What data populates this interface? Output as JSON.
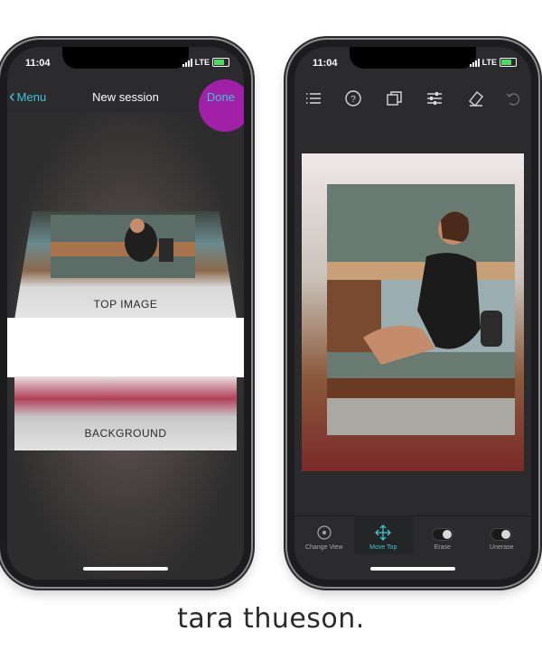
{
  "left_phone": {
    "status": {
      "time": "11:04",
      "network": "LTE"
    },
    "nav": {
      "back_label": "Menu",
      "title": "New session",
      "done_label": "Done"
    },
    "layers": {
      "top_label": "TOP IMAGE",
      "background_label": "BACKGROUND"
    }
  },
  "right_phone": {
    "status": {
      "time": "11:04",
      "network": "LTE"
    },
    "toolbar_icons": [
      "list-icon",
      "help-icon",
      "layers-icon",
      "sliders-icon",
      "eraser-icon",
      "undo-icon"
    ],
    "tabs": [
      {
        "label": "Change View",
        "icon": "change-view-icon"
      },
      {
        "label": "Move Top",
        "icon": "move-icon"
      },
      {
        "label": "Erase",
        "icon": "toggle-icon"
      },
      {
        "label": "Unerase",
        "icon": "toggle-icon"
      }
    ]
  },
  "brand": {
    "text": "tara thueson."
  },
  "colors": {
    "accent": "#3ec6d6",
    "highlight": "#a020a8",
    "screen_bg": "#2b2b2d"
  }
}
